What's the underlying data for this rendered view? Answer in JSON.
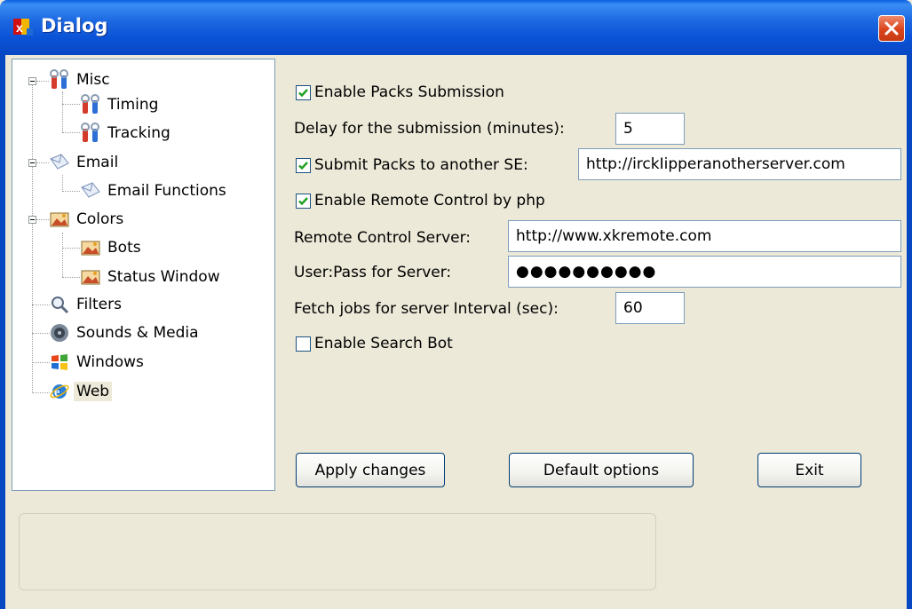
{
  "window": {
    "title": "Dialog",
    "app_icon": "xdcc-app-icon",
    "close_icon": "close-x-icon"
  },
  "tree": {
    "items": [
      {
        "label": "Misc",
        "icon": "wrench-tools-icon",
        "expanded": true
      },
      {
        "label": "Timing",
        "icon": "wrench-tools-icon"
      },
      {
        "label": "Tracking",
        "icon": "wrench-tools-icon"
      },
      {
        "label": "Email",
        "icon": "envelope-icon",
        "expanded": true
      },
      {
        "label": "Email Functions",
        "icon": "envelope-icon"
      },
      {
        "label": "Colors",
        "icon": "palette-picture-icon",
        "expanded": true
      },
      {
        "label": "Bots",
        "icon": "palette-picture-icon"
      },
      {
        "label": "Status Window",
        "icon": "palette-picture-icon"
      },
      {
        "label": "Filters",
        "icon": "magnifier-icon"
      },
      {
        "label": "Sounds & Media",
        "icon": "speaker-icon"
      },
      {
        "label": "Windows",
        "icon": "windows-logo-icon"
      },
      {
        "label": "Web",
        "icon": "internet-explorer-icon",
        "selected": true
      }
    ]
  },
  "settings": {
    "enable_packs_submission": {
      "label": "Enable Packs Submission",
      "checked": true
    },
    "delay_label": "Delay for the submission (minutes):",
    "delay_value": "5",
    "submit_another_se": {
      "label": "Submit Packs to another SE:",
      "checked": true
    },
    "another_se_url": "http://irckIipperanotherserver.com",
    "enable_remote_control": {
      "label": "Enable Remote Control by php",
      "checked": true
    },
    "remote_server_label": "Remote Control Server:",
    "remote_server_value": "http://www.xkremote.com",
    "userpass_label": "User:Pass for Server:",
    "userpass_value": "●●●●●●●●●●",
    "fetch_interval_label": "Fetch jobs for server Interval (sec):",
    "fetch_interval_value": "60",
    "enable_search_bot": {
      "label": "Enable Search Bot",
      "checked": false
    }
  },
  "buttons": {
    "apply": "Apply changes",
    "default": "Default options",
    "exit": "Exit"
  },
  "colors": {
    "titlebar": "#0a52d6",
    "dialog_bg": "#ece9d8",
    "close_button": "#d9441c",
    "check_mark": "#21a121"
  }
}
